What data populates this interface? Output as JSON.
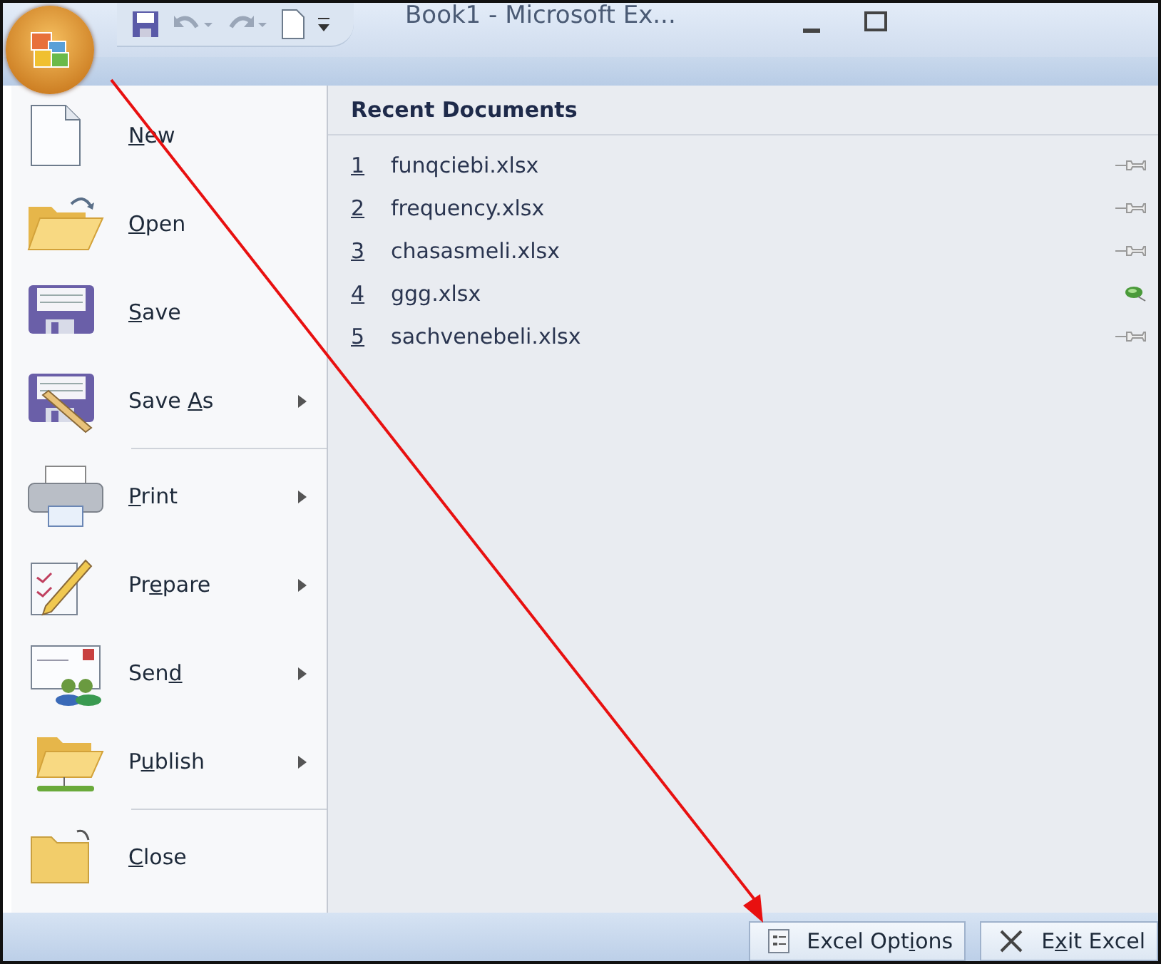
{
  "window": {
    "title": "Book1 - Microsoft Ex..."
  },
  "menu_items": [
    {
      "label": {
        "key": "N",
        "post": "ew"
      },
      "has_submenu": false,
      "divider_after": false
    },
    {
      "label": {
        "key": "O",
        "post": "pen"
      },
      "has_submenu": false,
      "divider_after": false
    },
    {
      "label": {
        "key": "S",
        "post": "ave"
      },
      "has_submenu": false,
      "divider_after": false
    },
    {
      "label": {
        "pre": "Save ",
        "key": "A",
        "post": "s"
      },
      "has_submenu": true,
      "divider_after": true
    },
    {
      "label": {
        "key": "P",
        "post": "rint"
      },
      "has_submenu": true,
      "divider_after": false
    },
    {
      "label": {
        "pre": "Pr",
        "key": "e",
        "post": "pare"
      },
      "has_submenu": true,
      "divider_after": false
    },
    {
      "label": {
        "pre": "Sen",
        "key": "d"
      },
      "has_submenu": true,
      "divider_after": false
    },
    {
      "label": {
        "pre": "P",
        "key": "u",
        "post": "blish"
      },
      "has_submenu": true,
      "divider_after": true
    },
    {
      "label": {
        "key": "C",
        "post": "lose"
      },
      "has_submenu": false,
      "divider_after": false
    }
  ],
  "recent_documents": {
    "heading": "Recent Documents",
    "items": [
      {
        "number": "1",
        "name": "funqciebi.xlsx",
        "pinned": false
      },
      {
        "number": "2",
        "name": "frequency.xlsx",
        "pinned": false
      },
      {
        "number": "3",
        "name": "chasasmeli.xlsx",
        "pinned": false
      },
      {
        "number": "4",
        "name": "ggg.xlsx",
        "pinned": true
      },
      {
        "number": "5",
        "name": "sachvenebeli.xlsx",
        "pinned": false
      }
    ]
  },
  "footer_buttons": [
    {
      "kind": "options",
      "label": {
        "pre": "Excel Opt",
        "key": "i",
        "post": "ons"
      }
    },
    {
      "kind": "exit",
      "label": {
        "pre": "E",
        "key": "x",
        "post": "it Excel"
      }
    }
  ]
}
